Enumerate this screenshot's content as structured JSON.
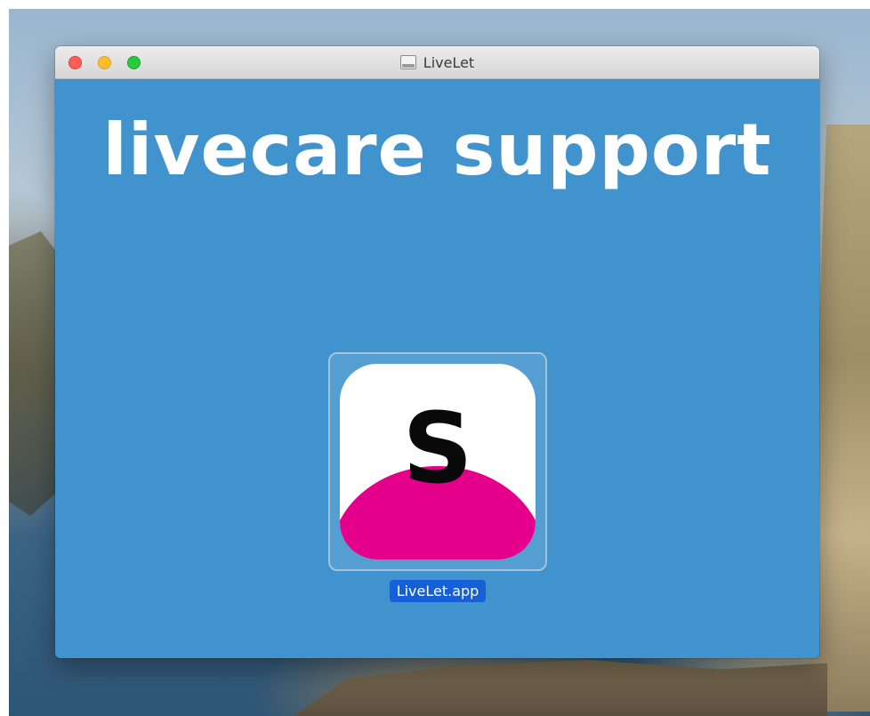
{
  "window": {
    "title": "LiveLet",
    "title_icon": "disk-image-icon"
  },
  "content": {
    "heading": "livecare support",
    "app": {
      "label": "LiveLet.app",
      "icon_glyph": "S",
      "icon_colors": {
        "background": "#ffffff",
        "blob": "#e5008c",
        "glyph": "#0a0a0a"
      }
    }
  },
  "colors": {
    "window_background": "#4193cd",
    "selection_label": "#1560d6",
    "traffic_close": "#ff5f57",
    "traffic_minimize": "#febc2e",
    "traffic_zoom": "#28c840"
  }
}
